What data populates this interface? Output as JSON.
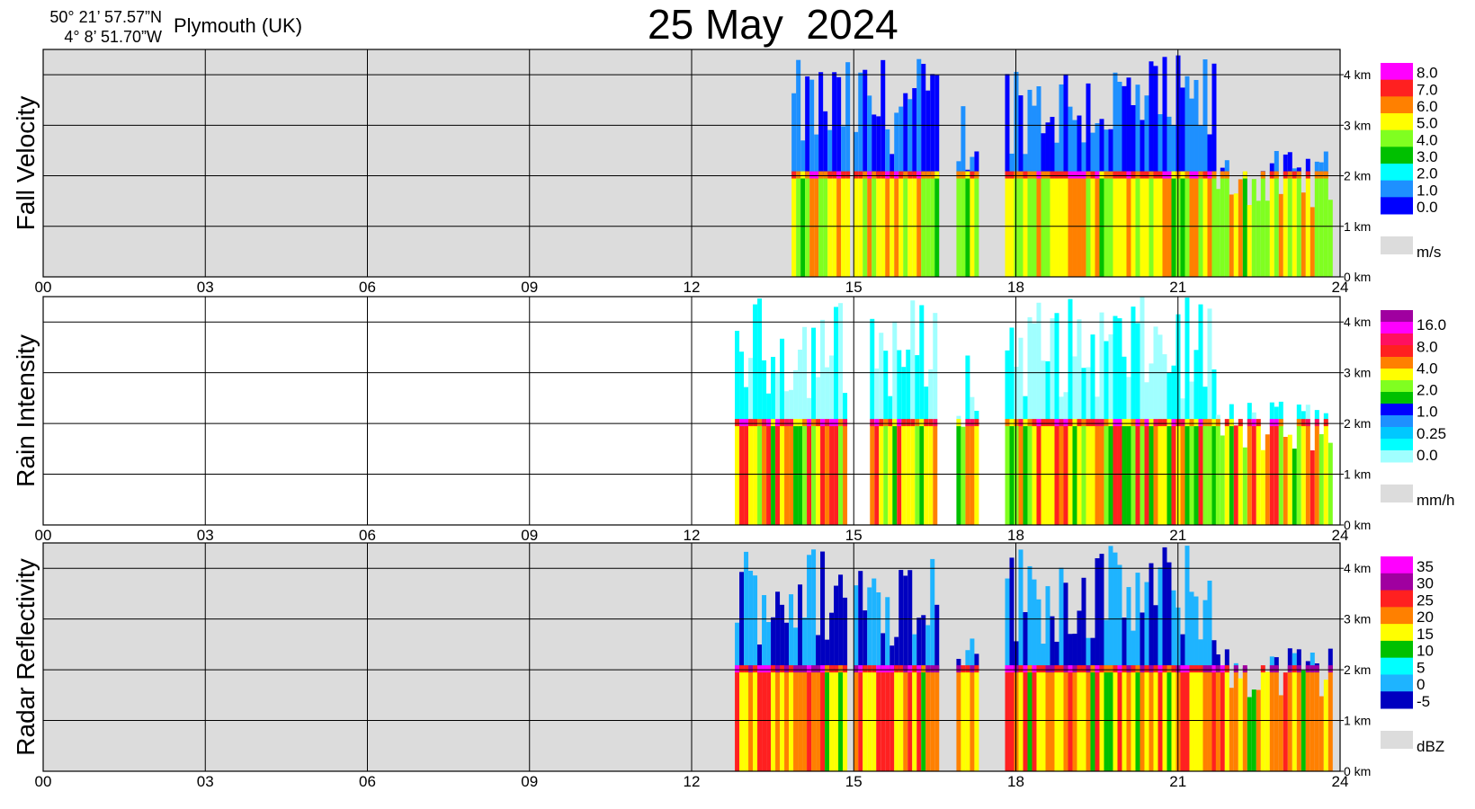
{
  "header": {
    "lat": "50° 21’ 57.57”N",
    "lon": "4°  8’ 51.70”W",
    "location": "Plymouth (UK)",
    "date": "25 May  2024"
  },
  "chart_data": [
    {
      "type": "heatmap",
      "title": "Fall Velocity",
      "x_ticks": [
        "00",
        "03",
        "06",
        "09",
        "12",
        "15",
        "18",
        "21",
        "24"
      ],
      "y_ticks": [
        "0 km",
        "1 km",
        "2 km",
        "3 km",
        "4 km"
      ],
      "xlim": [
        0,
        24
      ],
      "ylim": [
        0,
        4.5
      ],
      "grid": true,
      "colorbar": {
        "labels": [
          "8.0",
          "7.0",
          "6.0",
          "5.0",
          "4.0",
          "3.0",
          "2.0",
          "1.0",
          "0.0"
        ],
        "colors": [
          "#ff00ff",
          "#ff2020",
          "#ff8000",
          "#ffff00",
          "#80ff20",
          "#00c000",
          "#00ffff",
          "#1e90ff",
          "#0000ff"
        ],
        "unit": "m/s"
      },
      "echo_segments": [
        {
          "start": 13.85,
          "end": 14.85,
          "top_km": 4.3,
          "core": 5.0
        },
        {
          "start": 15.0,
          "end": 16.5,
          "top_km": 4.4,
          "core": 5.8
        },
        {
          "start": 16.9,
          "end": 17.3,
          "top_km": 3.6,
          "core": 4.5
        },
        {
          "start": 17.8,
          "end": 21.7,
          "top_km": 4.4,
          "core": 6.5
        },
        {
          "start": 21.7,
          "end": 23.8,
          "top_km": 2.5,
          "core": 1.5
        }
      ]
    },
    {
      "type": "heatmap",
      "title": "Rain Intensity",
      "x_ticks": [
        "00",
        "03",
        "06",
        "09",
        "12",
        "15",
        "18",
        "21",
        "24"
      ],
      "y_ticks": [
        "0 km",
        "1 km",
        "2 km",
        "3 km",
        "4 km"
      ],
      "xlim": [
        0,
        24
      ],
      "ylim": [
        0,
        4.5
      ],
      "grid": true,
      "colorbar": {
        "labels": [
          "16.0",
          "8.0",
          "4.0",
          "2.0",
          "1.0",
          "0.25",
          "0.0"
        ],
        "colors": [
          "#a000a0",
          "#ff00ff",
          "#ff1060",
          "#ff2020",
          "#ff8000",
          "#ffff00",
          "#80ff20",
          "#00c000",
          "#0000ff",
          "#1e90ff",
          "#00c8ff",
          "#00ffff",
          "#a0ffff"
        ],
        "unit": "mm/h"
      },
      "echo_segments": [
        {
          "start": 12.8,
          "end": 14.85,
          "top_km": 4.5,
          "core": 8.0
        },
        {
          "start": 15.3,
          "end": 16.5,
          "top_km": 4.5,
          "core": 4.0
        },
        {
          "start": 16.9,
          "end": 17.3,
          "top_km": 3.5,
          "core": 1.0
        },
        {
          "start": 17.8,
          "end": 21.7,
          "top_km": 4.5,
          "core": 16.0
        },
        {
          "start": 21.7,
          "end": 23.8,
          "top_km": 2.5,
          "core": 0.25
        }
      ]
    },
    {
      "type": "heatmap",
      "title": "Radar Reflectivity",
      "x_ticks": [
        "00",
        "03",
        "06",
        "09",
        "12",
        "15",
        "18",
        "21",
        "24"
      ],
      "y_ticks": [
        "0 km",
        "1 km",
        "2 km",
        "3 km",
        "4 km"
      ],
      "xlim": [
        0,
        24
      ],
      "ylim": [
        0,
        4.5
      ],
      "grid": true,
      "colorbar": {
        "labels": [
          "35",
          "30",
          "25",
          "20",
          "15",
          "10",
          "5",
          "0",
          "-5"
        ],
        "colors": [
          "#ff00ff",
          "#a000a0",
          "#ff2020",
          "#ff8000",
          "#ffff00",
          "#00c000",
          "#00ffff",
          "#1eb4ff",
          "#0000c0"
        ],
        "unit": "dBZ"
      },
      "echo_segments": [
        {
          "start": 12.8,
          "end": 14.85,
          "top_km": 4.5,
          "core": 22
        },
        {
          "start": 15.0,
          "end": 16.5,
          "top_km": 4.5,
          "core": 25
        },
        {
          "start": 16.9,
          "end": 17.3,
          "top_km": 3.6,
          "core": 12
        },
        {
          "start": 17.8,
          "end": 21.7,
          "top_km": 4.5,
          "core": 30
        },
        {
          "start": 21.7,
          "end": 23.8,
          "top_km": 2.5,
          "core": 8
        }
      ]
    }
  ]
}
